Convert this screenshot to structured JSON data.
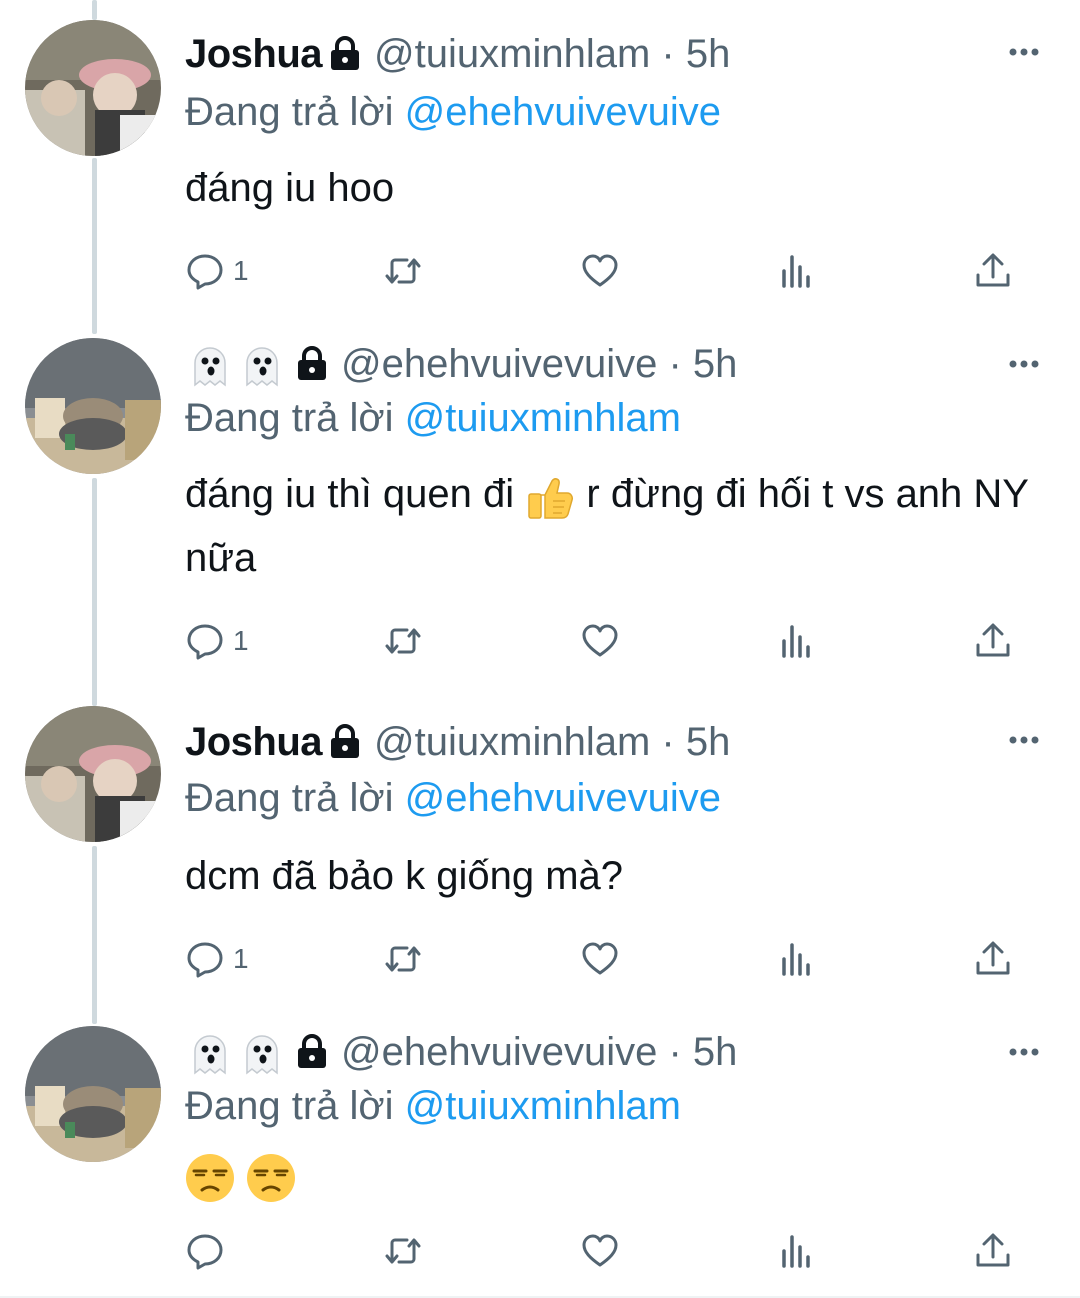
{
  "colors": {
    "accent": "#1d9bf0",
    "secondary_text": "#536471",
    "text": "#0f1419"
  },
  "tweets": [
    {
      "display_name": "Joshua",
      "meta": "@tuiuxminhlam · 5h",
      "reply_prefix": "Đang trả lời",
      "reply_mention": "@ehehvuivevuive",
      "text": "đáng iu hoo",
      "reply_count": "1"
    },
    {
      "display_name_icons": [
        "ghost-emoji",
        "ghost-emoji"
      ],
      "meta": "@ehehvuivevuive · 5h",
      "reply_prefix": "Đang trả lời",
      "reply_mention": "@tuiuxminhlam",
      "text_part1": "đáng iu thì quen đi",
      "text_emoji": "thumbs-up-emoji",
      "text_part2": "r đừng đi hối t vs anh NY nữa",
      "reply_count": "1"
    },
    {
      "display_name": "Joshua",
      "meta": "@tuiuxminhlam · 5h",
      "reply_prefix": "Đang trả lời",
      "reply_mention": "@ehehvuivevuive",
      "text": "dcm đã bảo k giống mà?",
      "reply_count": "1"
    },
    {
      "display_name_icons": [
        "ghost-emoji",
        "ghost-emoji"
      ],
      "meta": "@ehehvuivevuive · 5h",
      "reply_prefix": "Đang trả lời",
      "reply_mention": "@tuiuxminhlam",
      "text_emojis": [
        "unamused-face-emoji",
        "unamused-face-emoji"
      ],
      "reply_count": ""
    }
  ],
  "icons": {
    "lock": "lock-icon",
    "more": "more-horizontal-icon",
    "reply": "reply-icon",
    "retweet": "retweet-icon",
    "like": "like-icon",
    "views": "views-icon",
    "share": "share-icon"
  }
}
